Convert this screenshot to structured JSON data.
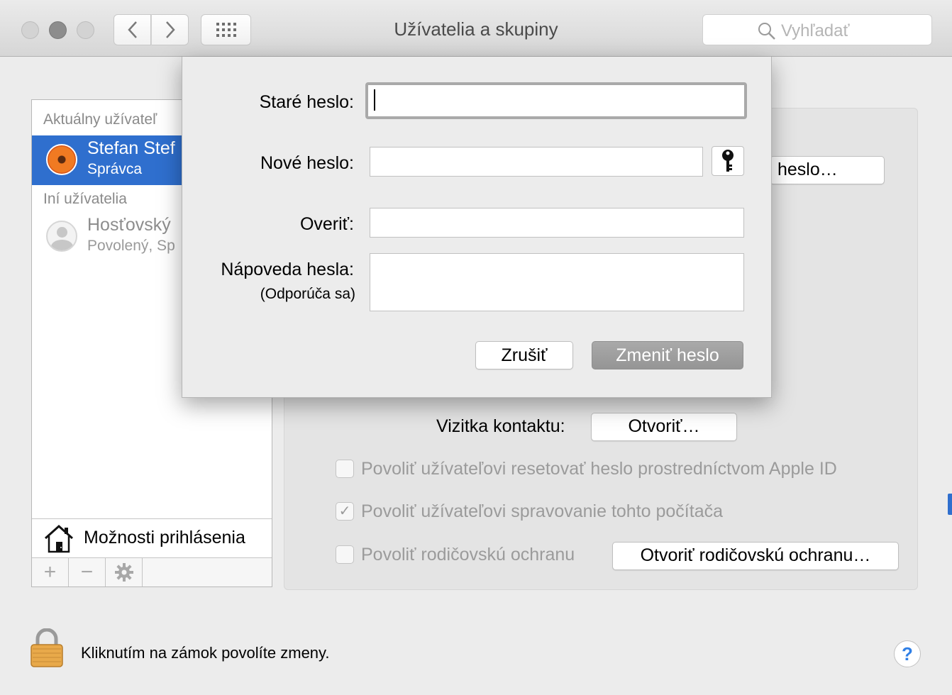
{
  "window": {
    "title": "Užívatelia a skupiny",
    "search_placeholder": "Vyhľadať"
  },
  "sidebar": {
    "current_user_header": "Aktuálny užívateľ",
    "current_user": {
      "name": "Stefan Stef",
      "role": "Správca"
    },
    "other_users_header": "Iní užívatelia",
    "other_users": [
      {
        "name": "Hosťovský",
        "role": "Povolený, Sp"
      }
    ],
    "login_options_label": "Možnosti prihlásenia",
    "toolbar": {
      "add": "+",
      "remove": "−"
    }
  },
  "pane": {
    "change_password_button": "heslo…",
    "contact_card_label": "Vizitka kontaktu:",
    "contact_card_button": "Otvoriť…",
    "options": [
      {
        "label": "Povoliť užívateľovi resetovať heslo prostredníctvom Apple ID",
        "checked": false
      },
      {
        "label": "Povoliť užívateľovi spravovanie tohto počítača",
        "checked": true
      },
      {
        "label": "Povoliť rodičovskú ochranu",
        "checked": false
      }
    ],
    "parental_button": "Otvoriť rodičovskú ochranu…"
  },
  "footer": {
    "lock_text": "Kliknutím na zámok povolíte zmeny.",
    "help": "?"
  },
  "dialog": {
    "old_password_label": "Staré heslo:",
    "new_password_label": "Nové heslo:",
    "verify_label": "Overiť:",
    "hint_label": "Nápoveda hesla:",
    "hint_sublabel": "(Odporúča sa)",
    "old_password_value": "",
    "new_password_value": "",
    "verify_value": "",
    "hint_value": "",
    "cancel_button": "Zrušiť",
    "confirm_button": "Zmeniť heslo"
  }
}
